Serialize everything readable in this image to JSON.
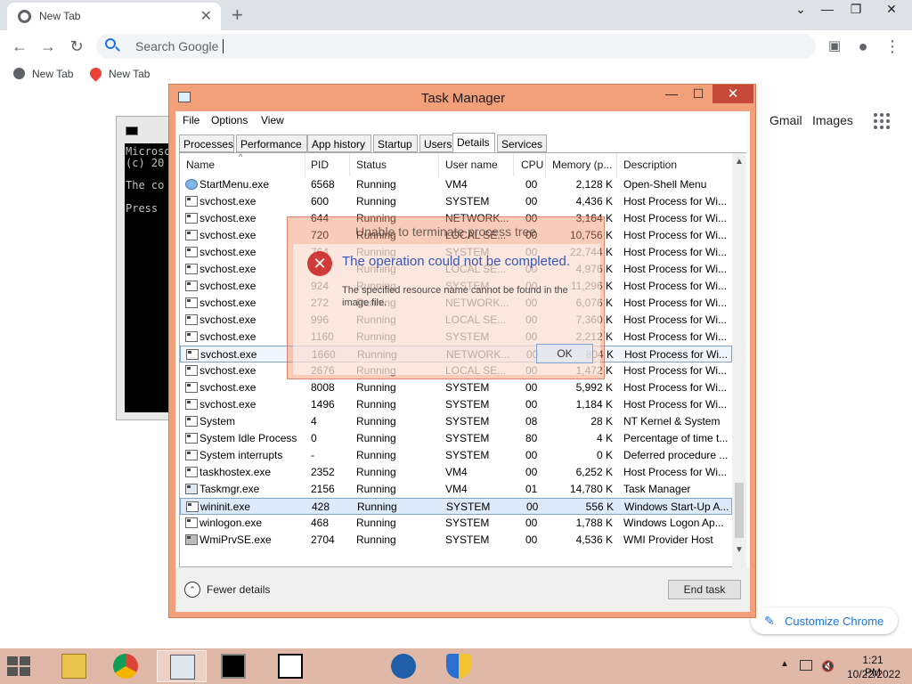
{
  "browser": {
    "tab_title": "New Tab",
    "omnibox_placeholder": "Search Google",
    "bookmarks": [
      "New Tab",
      "New Tab"
    ],
    "top_links": {
      "gmail": "Gmail",
      "images": "Images"
    },
    "customize": "Customize Chrome"
  },
  "console": {
    "lines": [
      "Microso",
      "(c) 20",
      "The co",
      "Press"
    ]
  },
  "taskmgr": {
    "title": "Task Manager",
    "menu": [
      "File",
      "Options",
      "View"
    ],
    "tabs": [
      "Processes",
      "Performance",
      "App history",
      "Startup",
      "Users",
      "Details",
      "Services"
    ],
    "active_tab": "Details",
    "columns": [
      "Name",
      "PID",
      "Status",
      "User name",
      "CPU",
      "Memory (p...",
      "Description"
    ],
    "rows": [
      {
        "name": "StartMenu.exe",
        "pid": "6568",
        "status": "Running",
        "user": "VM4",
        "cpu": "00",
        "mem": "2,128 K",
        "desc": "Open-Shell Menu"
      },
      {
        "name": "svchost.exe",
        "pid": "600",
        "status": "Running",
        "user": "SYSTEM",
        "cpu": "00",
        "mem": "4,436 K",
        "desc": "Host Process for Wi..."
      },
      {
        "name": "svchost.exe",
        "pid": "644",
        "status": "Running",
        "user": "NETWORK...",
        "cpu": "00",
        "mem": "3,164 K",
        "desc": "Host Process for Wi..."
      },
      {
        "name": "svchost.exe",
        "pid": "720",
        "status": "Running",
        "user": "LOCAL SE...",
        "cpu": "00",
        "mem": "10,756 K",
        "desc": "Host Process for Wi..."
      },
      {
        "name": "svchost.exe",
        "pid": "764",
        "status": "Running",
        "user": "SYSTEM",
        "cpu": "00",
        "mem": "22,744 K",
        "desc": "Host Process for Wi..."
      },
      {
        "name": "svchost.exe",
        "pid": "824",
        "status": "Running",
        "user": "LOCAL SE...",
        "cpu": "00",
        "mem": "4,976 K",
        "desc": "Host Process for Wi..."
      },
      {
        "name": "svchost.exe",
        "pid": "924",
        "status": "Running",
        "user": "SYSTEM",
        "cpu": "00",
        "mem": "11,296 K",
        "desc": "Host Process for Wi..."
      },
      {
        "name": "svchost.exe",
        "pid": "272",
        "status": "Running",
        "user": "NETWORK...",
        "cpu": "00",
        "mem": "6,076 K",
        "desc": "Host Process for Wi..."
      },
      {
        "name": "svchost.exe",
        "pid": "996",
        "status": "Running",
        "user": "LOCAL SE...",
        "cpu": "00",
        "mem": "7,360 K",
        "desc": "Host Process for Wi..."
      },
      {
        "name": "svchost.exe",
        "pid": "1160",
        "status": "Running",
        "user": "SYSTEM",
        "cpu": "00",
        "mem": "2,212 K",
        "desc": "Host Process for Wi..."
      },
      {
        "name": "svchost.exe",
        "pid": "1660",
        "status": "Running",
        "user": "NETWORK...",
        "cpu": "00",
        "mem": "804 K",
        "desc": "Host Process for Wi..."
      },
      {
        "name": "svchost.exe",
        "pid": "2676",
        "status": "Running",
        "user": "LOCAL SE...",
        "cpu": "00",
        "mem": "1,472 K",
        "desc": "Host Process for Wi..."
      },
      {
        "name": "svchost.exe",
        "pid": "8008",
        "status": "Running",
        "user": "SYSTEM",
        "cpu": "00",
        "mem": "5,992 K",
        "desc": "Host Process for Wi..."
      },
      {
        "name": "svchost.exe",
        "pid": "1496",
        "status": "Running",
        "user": "SYSTEM",
        "cpu": "00",
        "mem": "1,184 K",
        "desc": "Host Process for Wi..."
      },
      {
        "name": "System",
        "pid": "4",
        "status": "Running",
        "user": "SYSTEM",
        "cpu": "08",
        "mem": "28 K",
        "desc": "NT Kernel & System"
      },
      {
        "name": "System Idle Process",
        "pid": "0",
        "status": "Running",
        "user": "SYSTEM",
        "cpu": "80",
        "mem": "4 K",
        "desc": "Percentage of time t..."
      },
      {
        "name": "System interrupts",
        "pid": "-",
        "status": "Running",
        "user": "SYSTEM",
        "cpu": "00",
        "mem": "0 K",
        "desc": "Deferred procedure ..."
      },
      {
        "name": "taskhostex.exe",
        "pid": "2352",
        "status": "Running",
        "user": "VM4",
        "cpu": "00",
        "mem": "6,252 K",
        "desc": "Host Process for Wi..."
      },
      {
        "name": "Taskmgr.exe",
        "pid": "2156",
        "status": "Running",
        "user": "VM4",
        "cpu": "01",
        "mem": "14,780 K",
        "desc": "Task Manager"
      },
      {
        "name": "wininit.exe",
        "pid": "428",
        "status": "Running",
        "user": "SYSTEM",
        "cpu": "00",
        "mem": "556 K",
        "desc": "Windows Start-Up A..."
      },
      {
        "name": "winlogon.exe",
        "pid": "468",
        "status": "Running",
        "user": "SYSTEM",
        "cpu": "00",
        "mem": "1,788 K",
        "desc": "Windows Logon Ap..."
      },
      {
        "name": "WmiPrvSE.exe",
        "pid": "2704",
        "status": "Running",
        "user": "SYSTEM",
        "cpu": "00",
        "mem": "4,536 K",
        "desc": "WMI Provider Host"
      }
    ],
    "fewer_details": "Fewer details",
    "end_task": "End task"
  },
  "error_dialog": {
    "title": "Unable to terminate process tree",
    "main": "The operation could not be completed.",
    "detail": "The specified resource name cannot be found in the image file.",
    "ok": "OK"
  },
  "taskbar": {
    "time": "1:21 PM",
    "date": "10/22/2022"
  }
}
